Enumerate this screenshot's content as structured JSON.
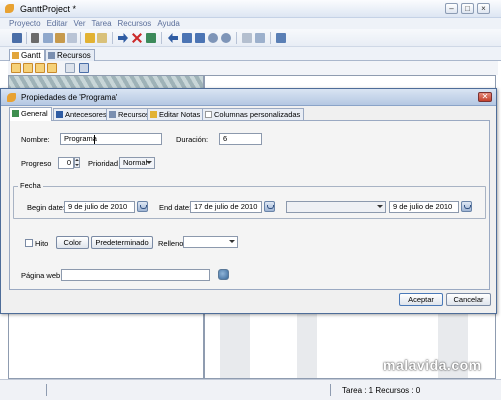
{
  "window": {
    "title": "GanttProject *",
    "menu": [
      "Proyecto",
      "Editar",
      "Ver",
      "Tarea",
      "Recursos",
      "Ayuda"
    ]
  },
  "main_tabs": [
    {
      "label": "Gantt",
      "icon": "gantt-icon"
    },
    {
      "label": "Recursos",
      "icon": "resources-icon"
    }
  ],
  "statusbar": {
    "tasks_resources": "Tarea : 1  Recursos : 0"
  },
  "watermark": "malavida.com",
  "dialog": {
    "title": "Propiedades de 'Programa'",
    "close_label": "✕",
    "tabs": [
      {
        "label": "General",
        "icon": "check-icon"
      },
      {
        "label": "Antecesores",
        "icon": "predecessors-icon"
      },
      {
        "label": "Recursos",
        "icon": "resources-icon"
      },
      {
        "label": "Editar Notas",
        "icon": "notes-icon"
      },
      {
        "label": "Columnas personalizadas",
        "icon": "columns-icon"
      }
    ],
    "general": {
      "name_label": "Nombre:",
      "name_value": "Programa",
      "duration_label": "Duración:",
      "duration_value": "6",
      "progress_label": "Progreso",
      "progress_value": "0",
      "priority_label": "Prioridad",
      "priority_value": "Normal",
      "dates_legend": "Fecha",
      "begin_label": "Begin date:",
      "begin_value": "9 de julio de 2010",
      "end_label": "End date:",
      "end_value": "17 de julio de 2010",
      "third_select_value": "",
      "third_date_value": "9 de julio de 2010",
      "milestone_label": "Hito",
      "color_button": "Color",
      "default_button": "Predeterminado",
      "fill_label": "Relleno",
      "fill_value": "",
      "webpage_label": "Página web",
      "webpage_value": ""
    },
    "accept_button": "Aceptar",
    "cancel_button": "Cancelar"
  }
}
